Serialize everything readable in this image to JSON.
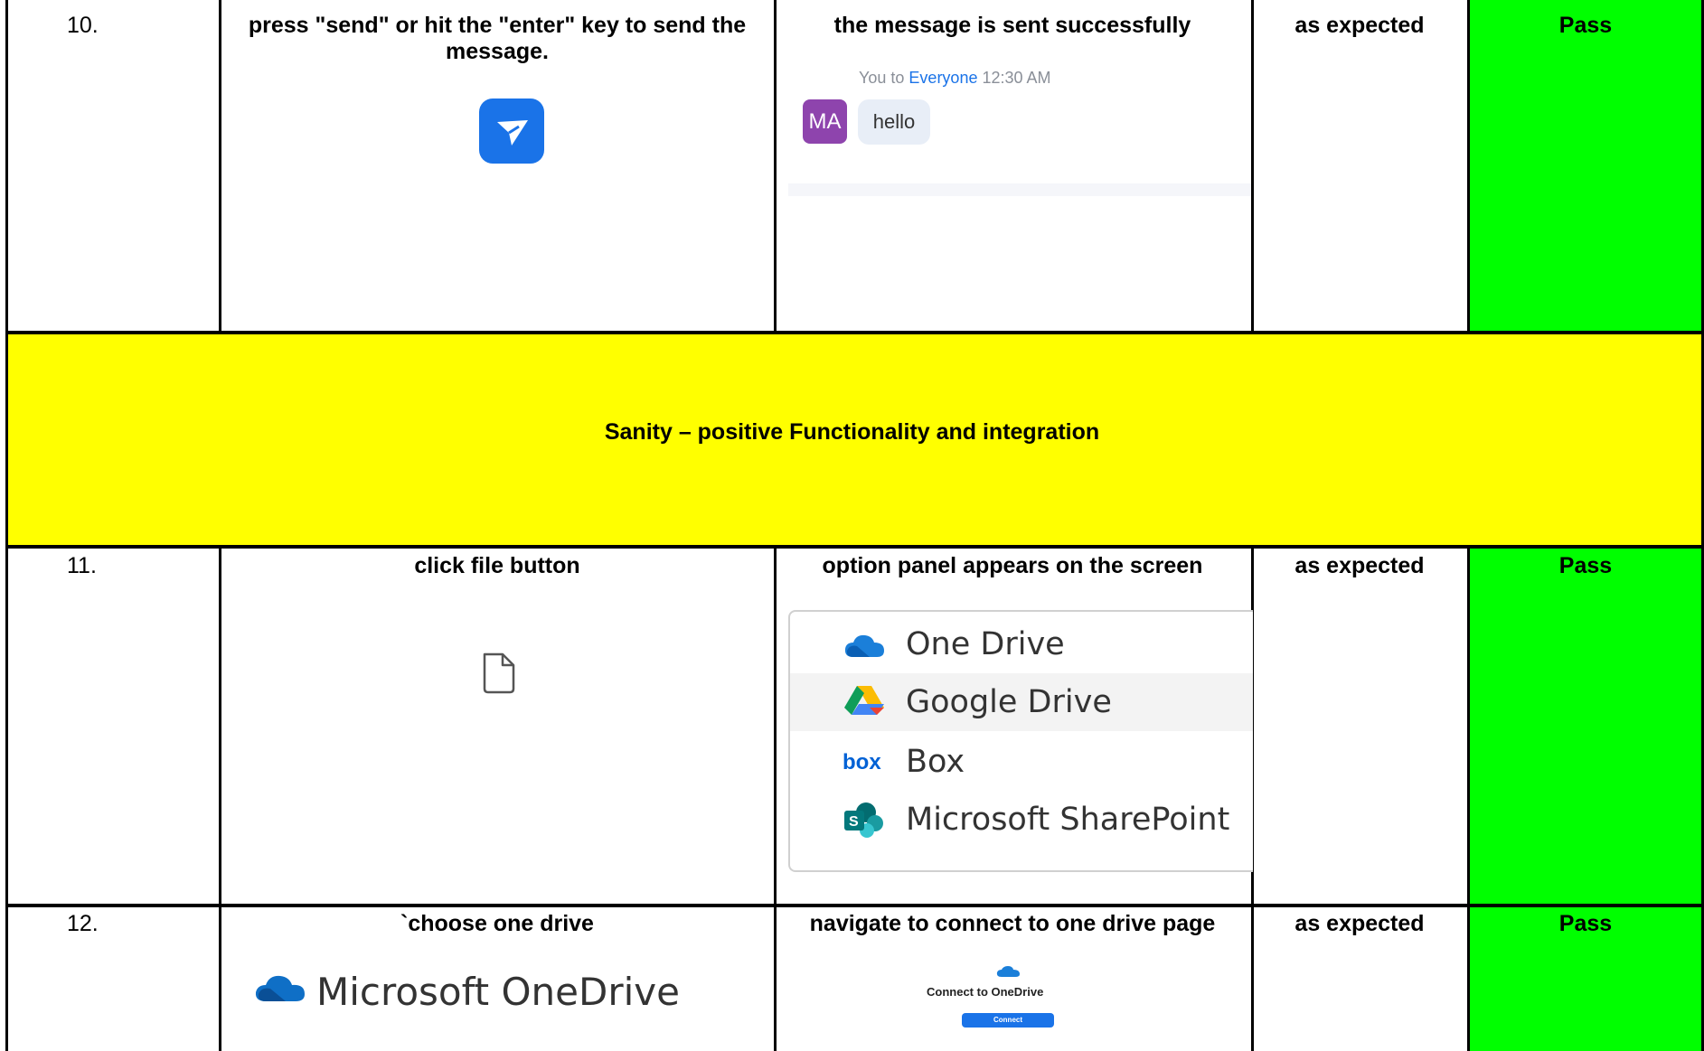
{
  "rows": [
    {
      "number": "10.",
      "step": "press \"send\" or hit the \"enter\" key to send the message.",
      "expected": "the message is sent successfully",
      "actual": "as expected",
      "result": "Pass",
      "chat": {
        "sender": "You",
        "to": "to",
        "recipient": "Everyone",
        "time": "12:30 AM",
        "avatar_initials": "MA",
        "message": "hello"
      }
    },
    {
      "number": "11.",
      "step": "click file button",
      "expected": "option panel appears on the screen",
      "actual": "as expected",
      "result": "Pass",
      "options": [
        {
          "label": "One Drive",
          "icon": "onedrive-icon"
        },
        {
          "label": "Google Drive",
          "icon": "google-drive-icon"
        },
        {
          "label": "Box",
          "icon": "box-icon"
        },
        {
          "label": "Microsoft SharePoint",
          "icon": "sharepoint-icon"
        }
      ]
    },
    {
      "number": "12.",
      "step": "`choose one drive",
      "expected": "navigate to connect to one drive page",
      "actual": "as expected",
      "result": "Pass",
      "brand": "Microsoft OneDrive",
      "connect": {
        "title": "Connect to OneDrive",
        "button": "Connect"
      }
    }
  ],
  "section_header": "Sanity – positive  Functionality and integration",
  "colors": {
    "pass": "#00ff00",
    "section": "#ffff00",
    "accent": "#1a73e8"
  }
}
